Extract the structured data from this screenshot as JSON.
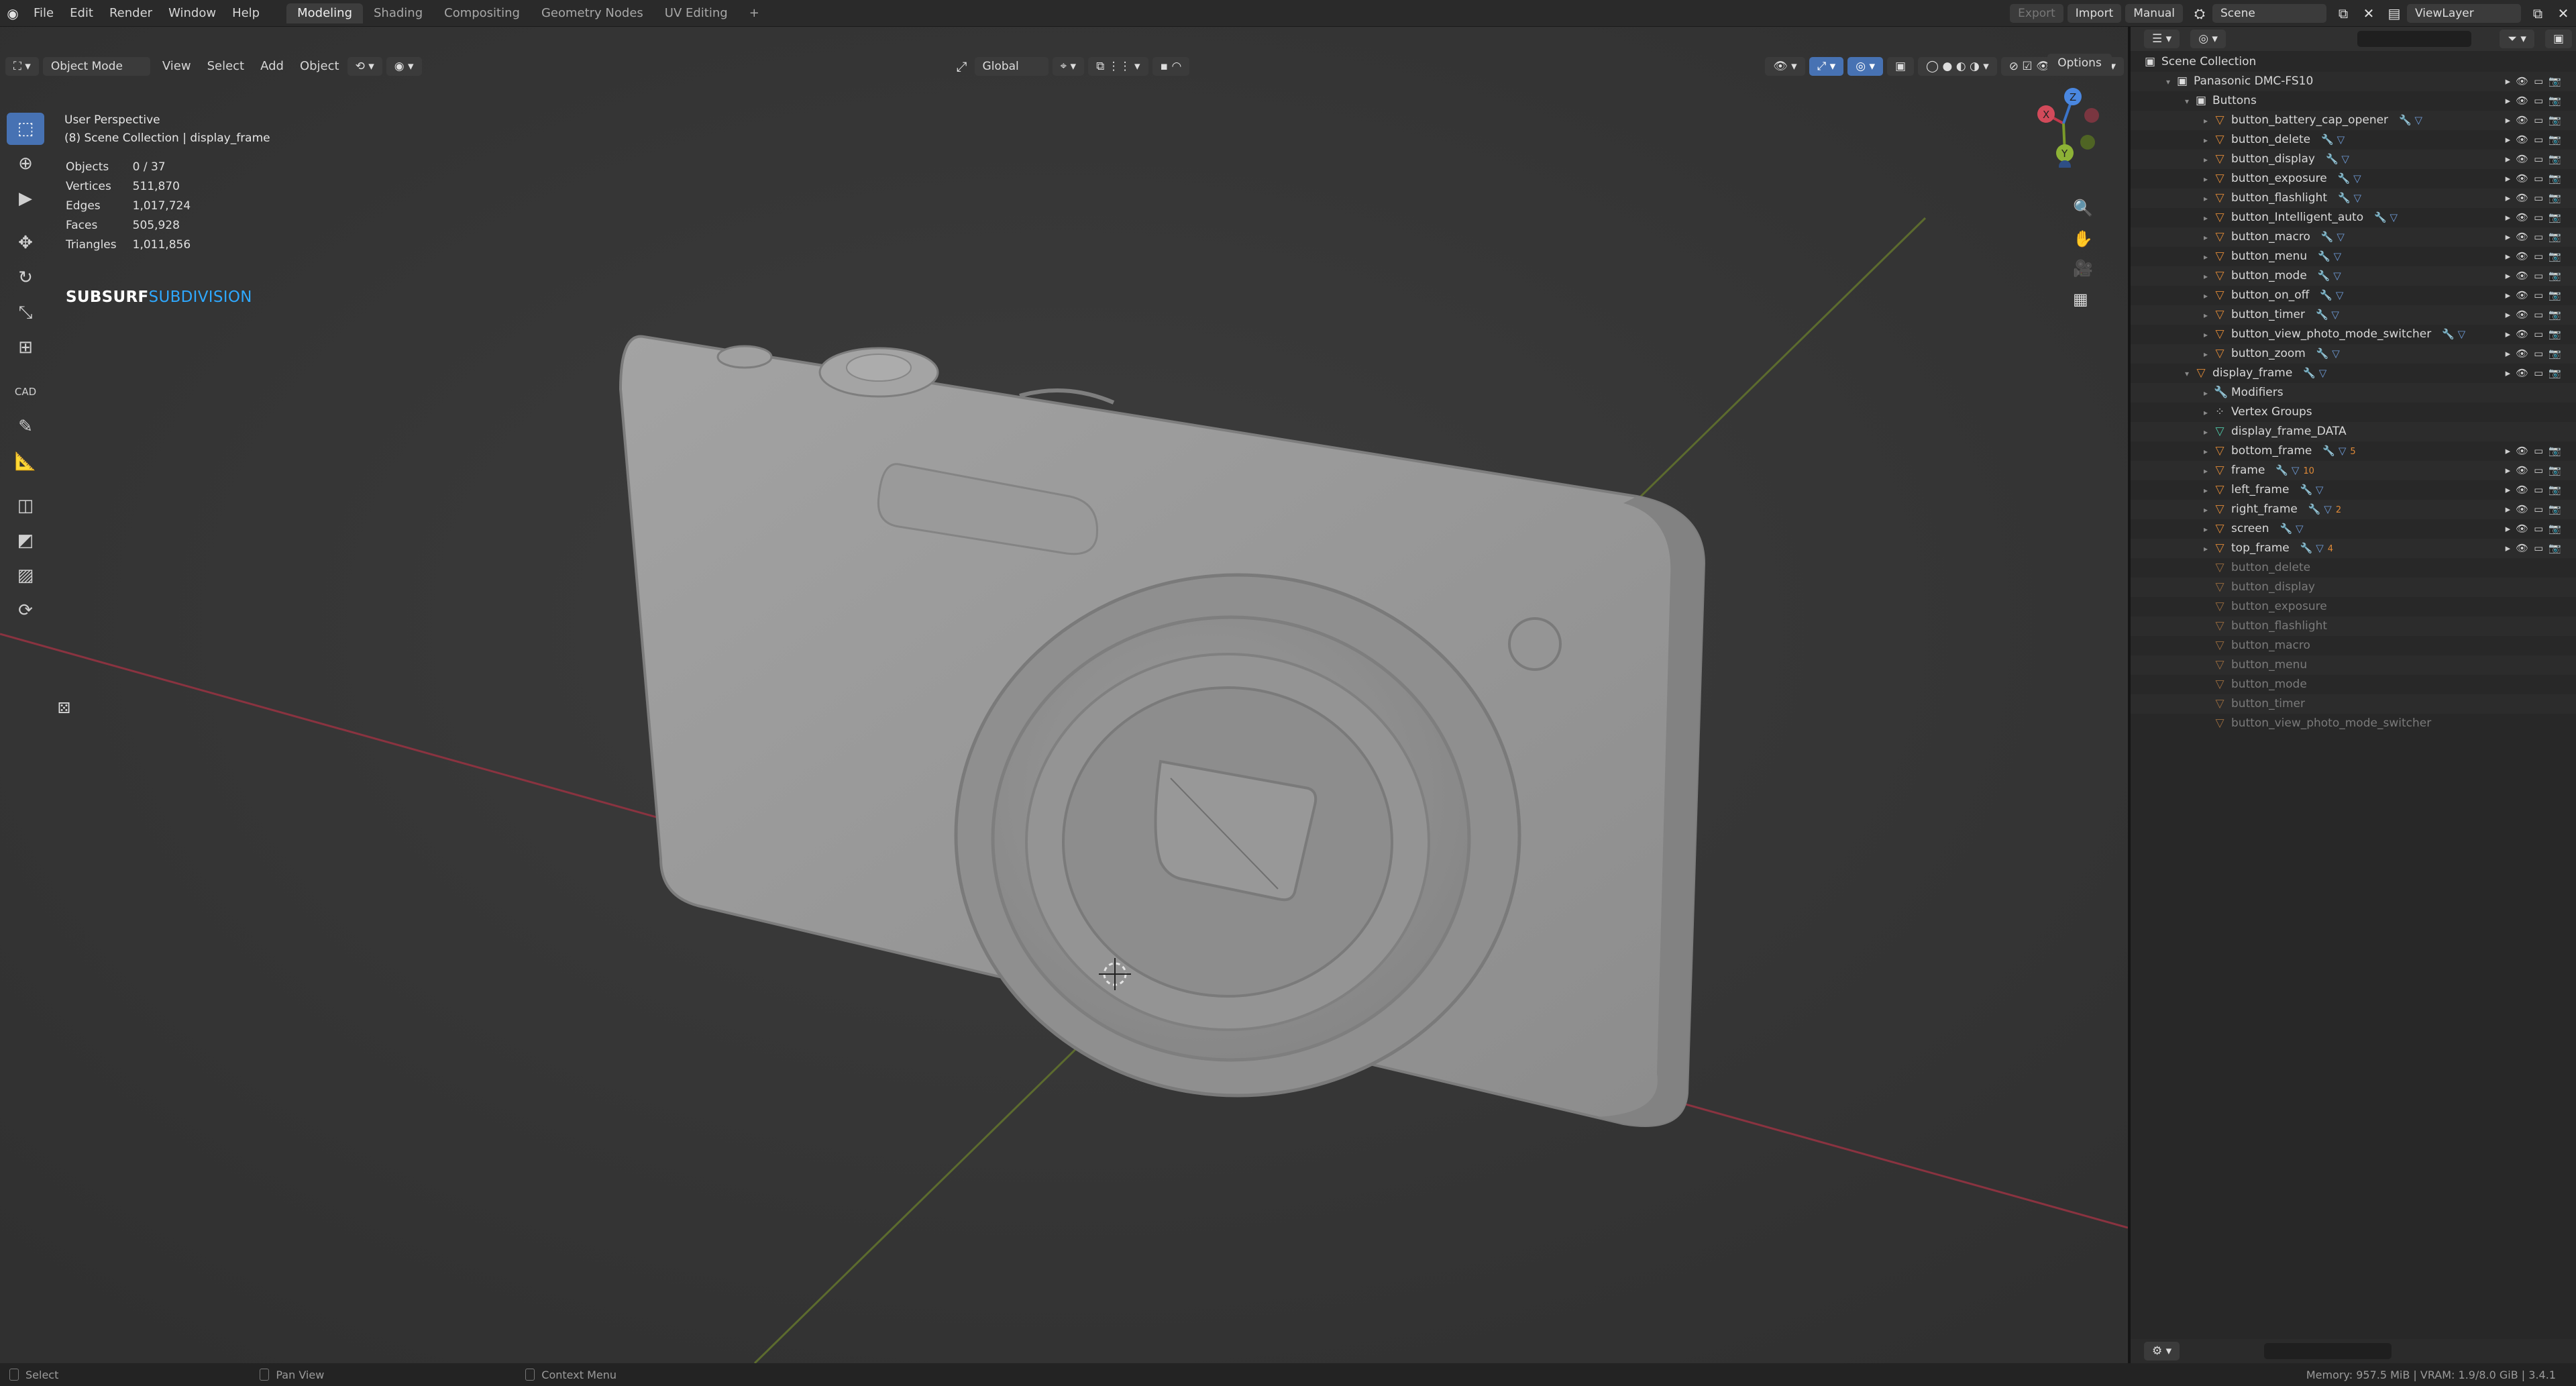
{
  "topbar": {
    "menus": [
      "File",
      "Edit",
      "Render",
      "Window",
      "Help"
    ],
    "workspaces": [
      "Modeling",
      "Shading",
      "Compositing",
      "Geometry Nodes",
      "UV Editing"
    ],
    "active_workspace": "Modeling",
    "add_workspace": "+",
    "export_label": "Export",
    "import_label": "Import",
    "manual_label": "Manual",
    "scene_name": "Scene",
    "view_layer": "ViewLayer"
  },
  "viewport_header": {
    "mode": "Object Mode",
    "menus": [
      "View",
      "Select",
      "Add",
      "Object"
    ],
    "orientation": "Global",
    "options_label": "Options"
  },
  "viewport": {
    "perspective": "User Perspective",
    "collection_info": "(8) Scene Collection | display_frame",
    "stats": [
      {
        "label": "Objects",
        "value": "0 / 37"
      },
      {
        "label": "Vertices",
        "value": "511,870"
      },
      {
        "label": "Edges",
        "value": "1,017,724"
      },
      {
        "label": "Faces",
        "value": "505,928"
      },
      {
        "label": "Triangles",
        "value": "1,011,856"
      }
    ],
    "subsurf_label_a": "SUBSURF",
    "subsurf_label_b": "SUBDIVISION",
    "gizmo_axes": [
      "X",
      "Y",
      "Z"
    ],
    "tool_cad_label": "CAD"
  },
  "outliner": {
    "root": "Scene Collection",
    "items": [
      {
        "label": "Panasonic DMC-FS10",
        "depth": 1,
        "type": "collection"
      },
      {
        "label": "Buttons",
        "depth": 2,
        "type": "collection"
      },
      {
        "label": "button_battery_cap_opener",
        "depth": 3,
        "type": "object"
      },
      {
        "label": "button_delete",
        "depth": 3,
        "type": "object"
      },
      {
        "label": "button_display",
        "depth": 3,
        "type": "object"
      },
      {
        "label": "button_exposure",
        "depth": 3,
        "type": "object"
      },
      {
        "label": "button_flashlight",
        "depth": 3,
        "type": "object"
      },
      {
        "label": "button_Intelligent_auto",
        "depth": 3,
        "type": "object"
      },
      {
        "label": "button_macro",
        "depth": 3,
        "type": "object"
      },
      {
        "label": "button_menu",
        "depth": 3,
        "type": "object"
      },
      {
        "label": "button_mode",
        "depth": 3,
        "type": "object"
      },
      {
        "label": "button_on_off",
        "depth": 3,
        "type": "object"
      },
      {
        "label": "button_timer",
        "depth": 3,
        "type": "object"
      },
      {
        "label": "button_view_photo_mode_switcher",
        "depth": 3,
        "type": "object"
      },
      {
        "label": "button_zoom",
        "depth": 3,
        "type": "object"
      },
      {
        "label": "display_frame",
        "depth": 2,
        "type": "object-active"
      },
      {
        "label": "Modifiers",
        "depth": 3,
        "type": "modifiers"
      },
      {
        "label": "Vertex Groups",
        "depth": 3,
        "type": "vgroups"
      },
      {
        "label": "display_frame_DATA",
        "depth": 3,
        "type": "mesh"
      },
      {
        "label": "bottom_frame",
        "depth": 3,
        "type": "object",
        "badge": "5"
      },
      {
        "label": "frame",
        "depth": 3,
        "type": "object",
        "badge": "10"
      },
      {
        "label": "left_frame",
        "depth": 3,
        "type": "object"
      },
      {
        "label": "right_frame",
        "depth": 3,
        "type": "object",
        "badge": "2"
      },
      {
        "label": "screen",
        "depth": 3,
        "type": "object"
      },
      {
        "label": "top_frame",
        "depth": 3,
        "type": "object",
        "badge": "4"
      },
      {
        "label": "button_delete",
        "depth": 3,
        "type": "ghost"
      },
      {
        "label": "button_display",
        "depth": 3,
        "type": "ghost"
      },
      {
        "label": "button_exposure",
        "depth": 3,
        "type": "ghost"
      },
      {
        "label": "button_flashlight",
        "depth": 3,
        "type": "ghost"
      },
      {
        "label": "button_macro",
        "depth": 3,
        "type": "ghost"
      },
      {
        "label": "button_menu",
        "depth": 3,
        "type": "ghost"
      },
      {
        "label": "button_mode",
        "depth": 3,
        "type": "ghost"
      },
      {
        "label": "button_timer",
        "depth": 3,
        "type": "ghost"
      },
      {
        "label": "button_view_photo_mode_switcher",
        "depth": 3,
        "type": "ghost"
      }
    ]
  },
  "statusbar": {
    "select": "Select",
    "pan": "Pan View",
    "context": "Context Menu",
    "memory": "Memory: 957.5 MiB | VRAM: 1.9/8.0 GiB | 3.4.1"
  },
  "colors": {
    "accent": "#4772b3",
    "subsurf_blue": "#2ea8ff",
    "object_orange": "#e08a37",
    "x_axis": "#c0384a",
    "y_axis": "#7a9a2a"
  }
}
